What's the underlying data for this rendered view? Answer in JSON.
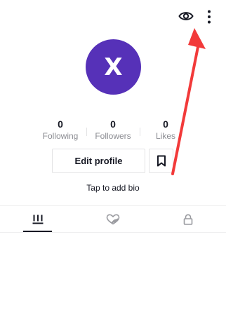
{
  "header": {
    "eye_icon": "eye-icon",
    "more_icon": "vertical-ellipsis-icon"
  },
  "profile": {
    "avatar_initial": "X",
    "avatar_color": "#5631b8"
  },
  "stats": {
    "following": {
      "count": "0",
      "label": "Following"
    },
    "followers": {
      "count": "0",
      "label": "Followers"
    },
    "likes": {
      "count": "0",
      "label": "Likes"
    }
  },
  "actions": {
    "edit_profile_label": "Edit profile",
    "bookmark_icon": "bookmark-icon"
  },
  "bio": {
    "placeholder": "Tap to add bio"
  },
  "tabs": [
    {
      "name": "videos",
      "icon": "grid-bars-icon",
      "active": true
    },
    {
      "name": "liked",
      "icon": "heart-hidden-icon",
      "active": false
    },
    {
      "name": "private",
      "icon": "lock-icon",
      "active": false
    }
  ],
  "annotation": {
    "arrow_color": "#f23a3a"
  }
}
